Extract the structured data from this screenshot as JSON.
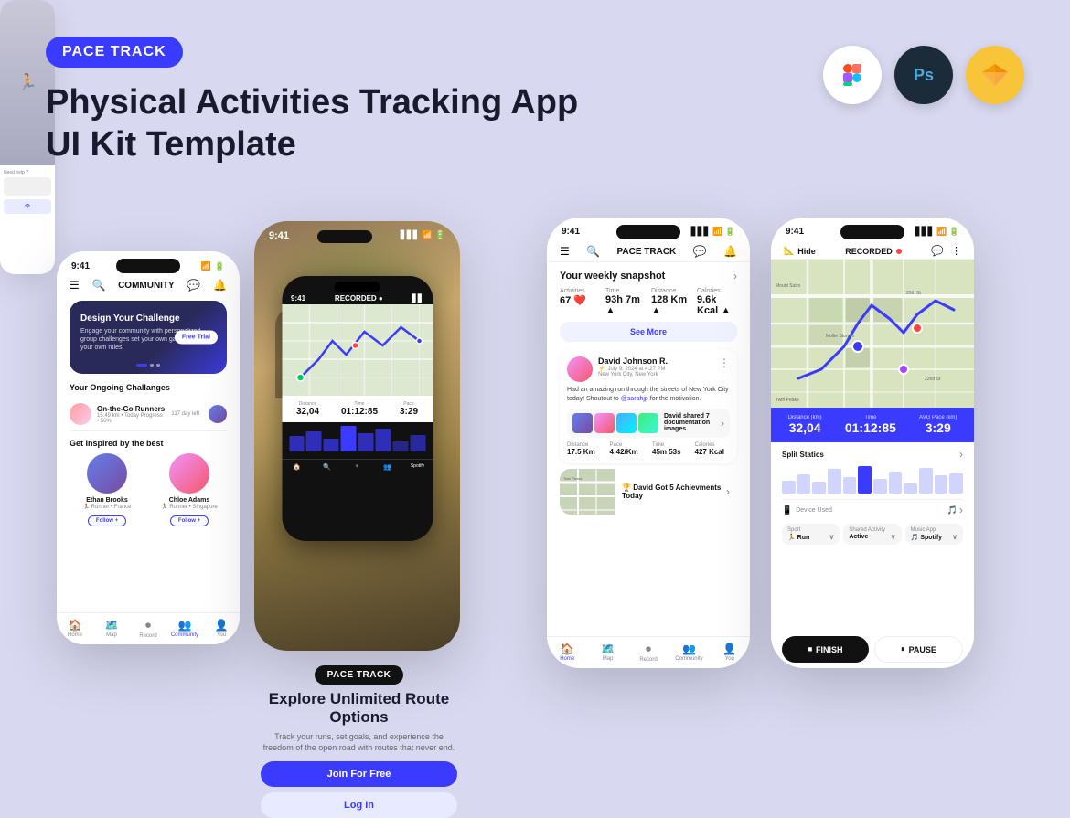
{
  "header": {
    "logo": "PACE TRACK",
    "headline_line1": "Physical Activities Tracking App",
    "headline_line2": "UI Kit Template"
  },
  "tools": [
    {
      "name": "Figma",
      "symbol": "🎨",
      "bg": "white"
    },
    {
      "name": "Photoshop",
      "symbol": "Ps",
      "bg": "#1c2b3a"
    },
    {
      "name": "Sketch",
      "symbol": "💎",
      "bg": "#f8c53a"
    }
  ],
  "phone1": {
    "status_time": "9:41",
    "nav_title": "COMMUNITY",
    "banner_title": "Design Your Challenge",
    "banner_desc": "Engage your community with personalized group challenges set your own game and make your own rules.",
    "banner_btn": "Free Trial",
    "ongoing_title": "Your Ongoing Challanges",
    "challenge_name": "On-the-Go Runners",
    "challenge_days": "117 day left",
    "challenge_sub": "15.49 km  •  Today Progress  •  56%",
    "inspire_title": "Get Inspired by the best",
    "runners": [
      {
        "name": "Ethan Brooks",
        "type": "Runner • France",
        "btn": "Follow +"
      },
      {
        "name": "Chloe Adams",
        "type": "Runner • Singapore",
        "btn": "Follow +"
      }
    ],
    "nav_items": [
      "Home",
      "Map",
      "Record",
      "Community",
      "You"
    ],
    "nav_active": "Community"
  },
  "phone2_label": {
    "badge": "PACE TRACK",
    "title": "Explore Unlimited Route Options",
    "desc": "Track your runs, set goals, and experience the freedom of the open road with routes that never end.",
    "btn_primary": "Join For Free",
    "btn_secondary": "Log In"
  },
  "phone2_inner": {
    "distance": "32,04",
    "time": "01:12:85",
    "pace": "3:29",
    "status": "RECORDED"
  },
  "phone3": {
    "status_time": "9:41",
    "app_name": "PACE TRACK",
    "weekly_title": "Your weekly snapshot",
    "stats": {
      "activities": {
        "label": "Activities",
        "value": "67",
        "icon": "❤️"
      },
      "time": {
        "label": "Time",
        "value": "93h 7m",
        "icon": "▲"
      },
      "distance": {
        "label": "Distance",
        "value": "128 Km",
        "icon": "▲"
      },
      "calories": {
        "label": "Calories",
        "value": "9.6k Kcal",
        "icon": "▲"
      }
    },
    "see_more": "See More",
    "post": {
      "name": "David Johnson R.",
      "time": "July 9, 2024 at 4:27 PM",
      "location": "New York City, New York",
      "body": "Had an amazing run through the streets of New York City today! Shoutout to",
      "mention": "@sarahjp",
      "body2": "for the motivation.",
      "shared": "David shared 7 documentation images.",
      "distance": "17.5 Km",
      "pace": "4:42/Km",
      "time_stat": "45m 53s",
      "calories": "427 Kcal"
    },
    "achievement": "David Got 5 Achievments Today",
    "nav_items": [
      "Home",
      "Map",
      "Record",
      "Community",
      "You"
    ],
    "nav_active": "Home"
  },
  "phone4": {
    "status_time": "9:41",
    "hide_label": "Hide",
    "recorded_label": "RECORDED",
    "metrics": {
      "distance": {
        "label": "Distance (km)",
        "value": "32,04"
      },
      "time": {
        "label": "Time",
        "value": "01:12:85"
      },
      "avg_pace": {
        "label": "AVG Pace (km)",
        "value": "3:29"
      }
    },
    "split_title": "Split Statics",
    "device_label": "Device Used",
    "sport_label": "Sport",
    "sport_value": "Run",
    "shared_label": "Shared Activity",
    "shared_value": "Active",
    "music_label": "Music App",
    "music_value": "Spotify",
    "finish_btn": "FINISH",
    "pause_btn": "PAUSE",
    "bars": [
      40,
      55,
      35,
      70,
      50,
      80,
      45,
      65,
      30,
      75,
      55,
      60
    ]
  }
}
